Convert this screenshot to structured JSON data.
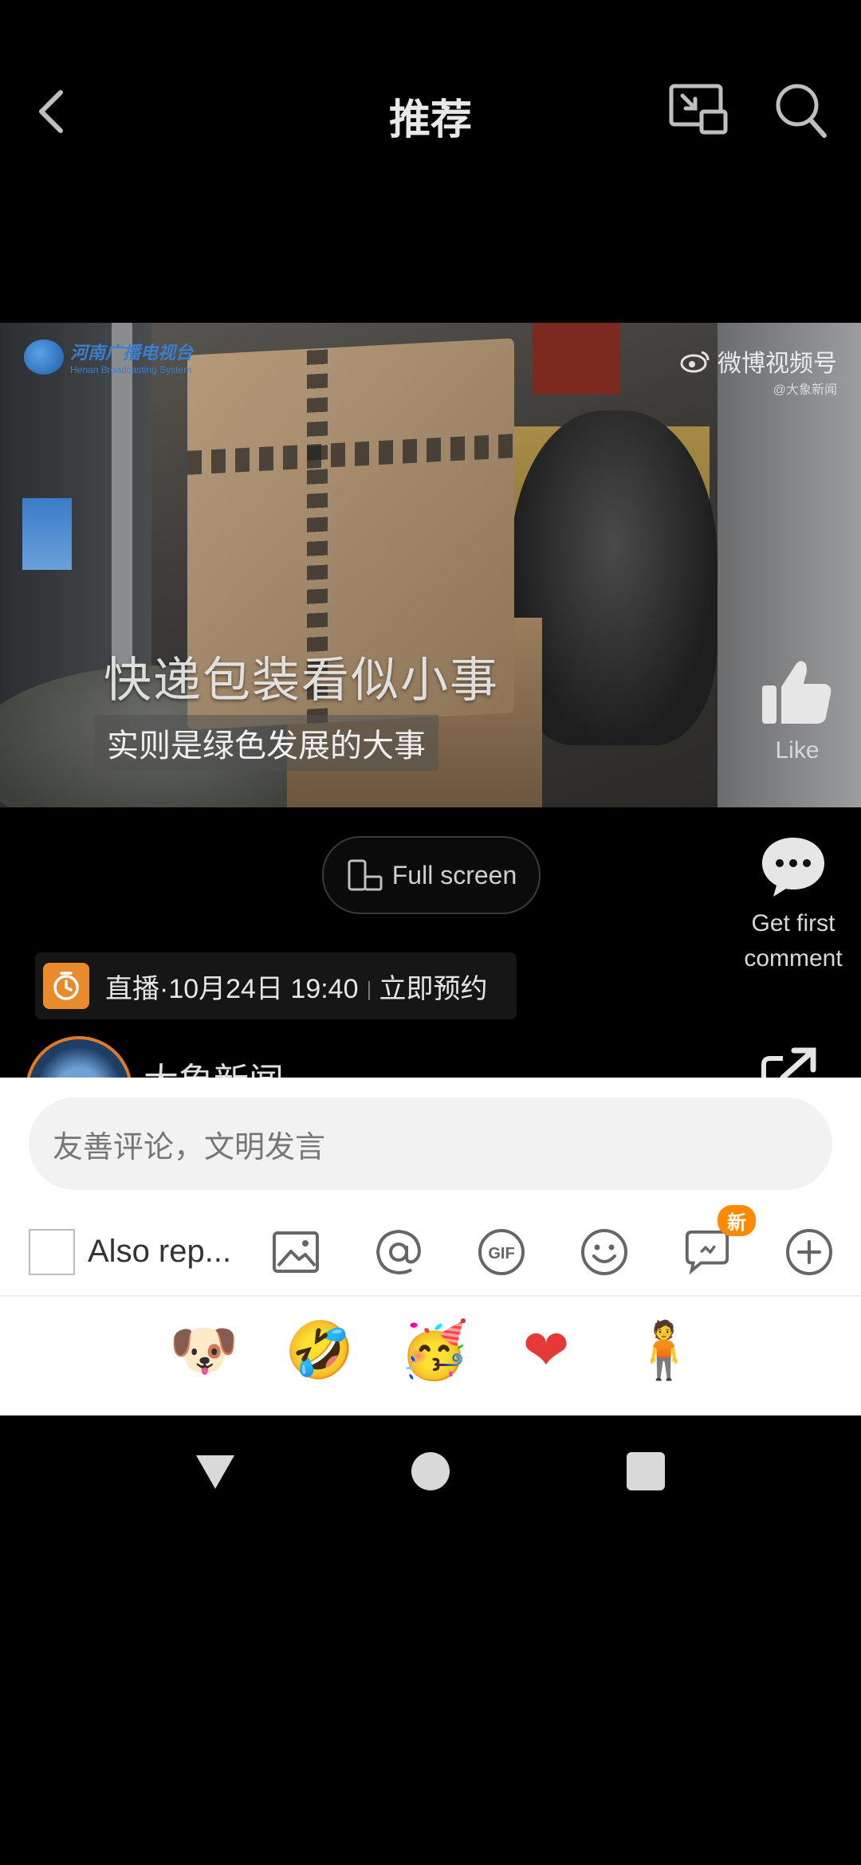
{
  "header": {
    "title": "推荐",
    "icons": {
      "back": "back-chevron-icon",
      "pip": "picture-in-picture-icon",
      "search": "search-icon"
    }
  },
  "video": {
    "watermark_left": "河南广播电视台",
    "watermark_left_sub": "Henan Broadcasting System",
    "watermark_right": "微博视频号",
    "watermark_right_sub": "@大象新闻",
    "caption_line1": "快递包装看似小事",
    "caption_line2": "实则是绿色发展的大事"
  },
  "actions": {
    "like_label": "Like",
    "fullscreen_label": "Full screen",
    "comment_label_line1": "Get first",
    "comment_label_line2": "comment"
  },
  "live": {
    "text": "直播·10月24日 19:40",
    "action": "立即预约"
  },
  "author": {
    "name": "大象新闻"
  },
  "compose": {
    "placeholder": "友善评论，文明发言",
    "also_repost_label": "Also rep...",
    "new_badge": "新",
    "tools": [
      "image-icon",
      "at-mention-icon",
      "gif-icon",
      "emoji-face-icon",
      "chat-bubble-icon",
      "plus-circle-icon"
    ]
  },
  "emoji_bar": {
    "items": [
      {
        "name": "crying-emoji",
        "glyph": "😭"
      },
      {
        "name": "doge-emoji",
        "glyph": "🐶"
      },
      {
        "name": "rolling-laughing-emoji",
        "glyph": "🤣"
      },
      {
        "name": "cheering-emoji",
        "glyph": "🥳"
      },
      {
        "name": "red-heart-emoji",
        "glyph": "❤"
      },
      {
        "name": "hugging-person-emoji",
        "glyph": "🧍"
      },
      {
        "name": "tears-of-joy-emoji",
        "glyph": "😂"
      }
    ]
  },
  "colors": {
    "accent_orange": "#e98a2d",
    "badge_orange": "#ff8a00",
    "heart_red": "#e53935"
  }
}
